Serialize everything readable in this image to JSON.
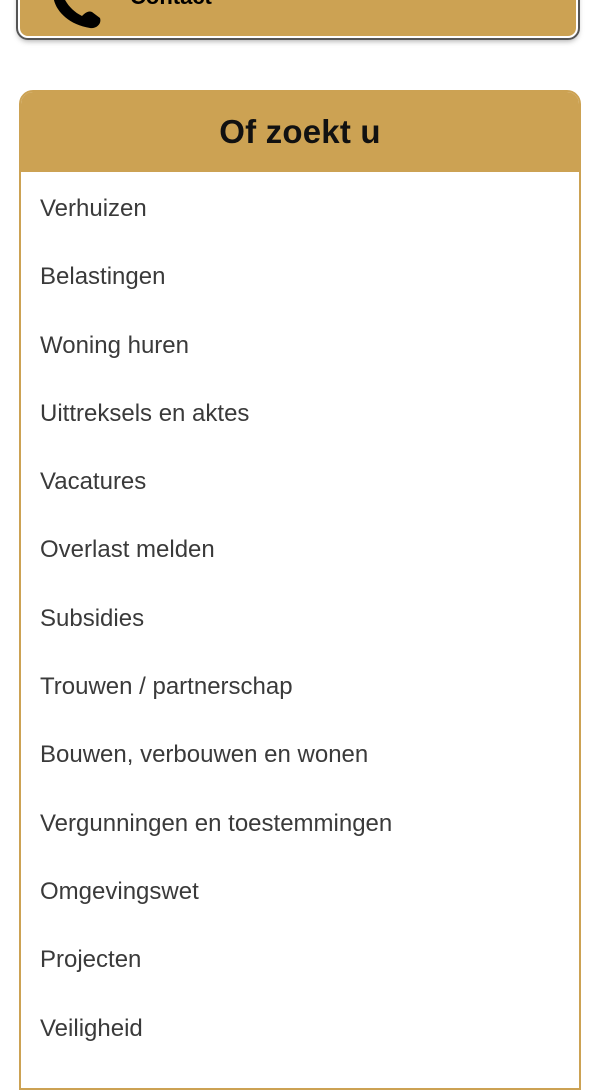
{
  "contact": {
    "label": "Contact",
    "icon": "phone-icon"
  },
  "panel": {
    "title": "Of zoekt u",
    "accent_color": "#cca253",
    "items": [
      {
        "label": "Verhuizen"
      },
      {
        "label": "Belastingen"
      },
      {
        "label": "Woning huren"
      },
      {
        "label": "Uittreksels en aktes"
      },
      {
        "label": "Vacatures"
      },
      {
        "label": "Overlast melden"
      },
      {
        "label": "Subsidies"
      },
      {
        "label": "Trouwen / partnerschap"
      },
      {
        "label": "Bouwen, verbouwen en wonen"
      },
      {
        "label": "Vergunningen en toestemmingen"
      },
      {
        "label": "Omgevingswet"
      },
      {
        "label": "Projecten"
      },
      {
        "label": "Veiligheid"
      }
    ]
  }
}
